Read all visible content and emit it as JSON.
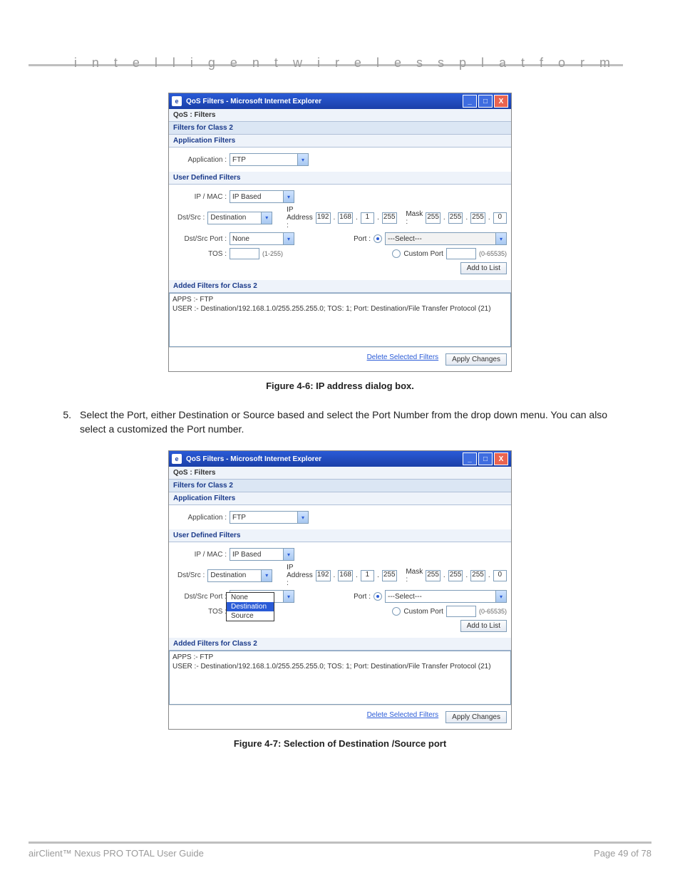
{
  "header": {
    "title": "i n t e l l i g e n t   w i r e l e s s   p l a t f o r m"
  },
  "fig1": {
    "titlebar": "QoS Filters - Microsoft Internet Explorer",
    "qos": "QoS : Filters",
    "filters_for": "Filters for Class 2",
    "app_filters": "Application Filters",
    "app_lbl": "Application :",
    "app_val": "FTP",
    "udf": "User Defined Filters",
    "ipmac_lbl": "IP / MAC :",
    "ipmac_val": "IP Based",
    "dstsrc_lbl": "Dst/Src :",
    "dstsrc_val": "Destination",
    "ipaddr_lbl": "IP Address :",
    "ip": [
      "192",
      "168",
      "1",
      "255"
    ],
    "mask_lbl": "Mask :",
    "mask": [
      "255",
      "255",
      "255",
      "0"
    ],
    "dstport_lbl": "Dst/Src Port :",
    "dstport_val": "None",
    "port_lbl": "Port :",
    "port_select": "---Select---",
    "custom_lbl": "Custom Port",
    "custom_range": "(0-65535)",
    "tos_lbl": "TOS :",
    "tos_range": "(1-255)",
    "add_btn": "Add to List",
    "added_hdr": "Added Filters for Class 2",
    "added_l1": "APPS :- FTP",
    "added_l2": "USER :- Destination/192.168.1.0/255.255.255.0; TOS: 1; Port: Destination/File Transfer Protocol (21)",
    "delete": "Delete Selected Filters",
    "apply": "Apply Changes",
    "caption": "Figure 4-6: IP address dialog box."
  },
  "step5": {
    "num": "5.",
    "text": "Select the Port, either Destination or Source based and select the Port Number from the drop down menu. You can also select a customized the Port number."
  },
  "fig2": {
    "titlebar": "QoS Filters - Microsoft Internet Explorer",
    "dstport_val": "Destination",
    "mask4": "0",
    "dlist": [
      "None",
      "Destination",
      "Source"
    ],
    "caption": "Figure 4-7: Selection of Destination /Source port"
  },
  "footer": {
    "left": "airClient™ Nexus PRO TOTAL User Guide",
    "right": "Page 49 of 78"
  }
}
